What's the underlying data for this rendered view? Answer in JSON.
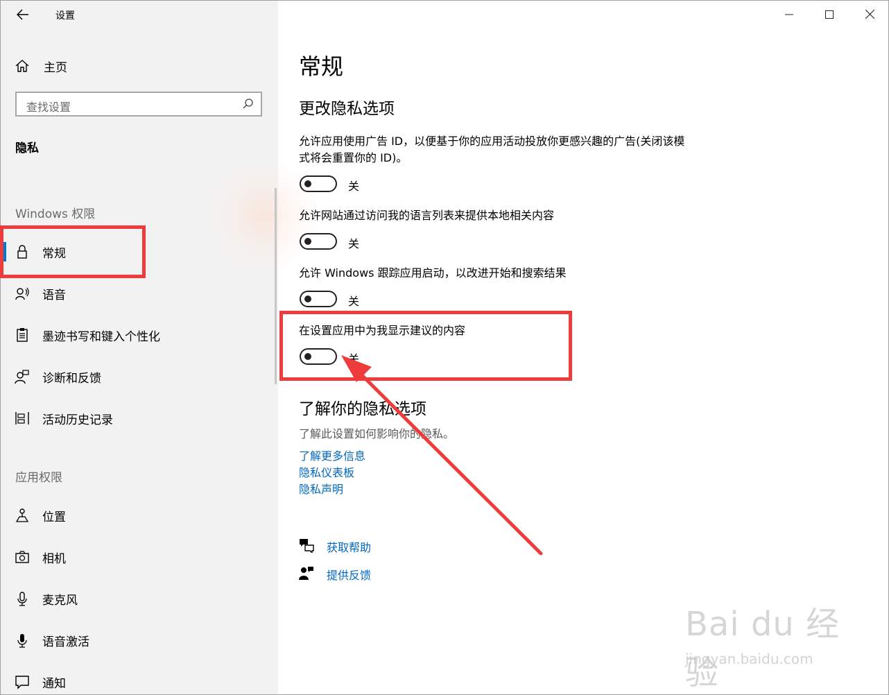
{
  "window": {
    "title": "设置",
    "controls": {
      "minimize": "—",
      "maximize": "☐",
      "close": "✕"
    }
  },
  "sidebar": {
    "home_label": "主页",
    "search_placeholder": "查找设置",
    "section_title": "隐私",
    "windows_group_label": "Windows 权限",
    "windows_items": [
      {
        "label": "常规",
        "icon": "lock-icon",
        "active": true
      },
      {
        "label": "语音",
        "icon": "speech-icon"
      },
      {
        "label": "墨迹书写和键入个性化",
        "icon": "clipboard-icon"
      },
      {
        "label": "诊断和反馈",
        "icon": "feedback-person-icon"
      },
      {
        "label": "活动历史记录",
        "icon": "timeline-icon"
      }
    ],
    "app_group_label": "应用权限",
    "app_items": [
      {
        "label": "位置",
        "icon": "location-icon"
      },
      {
        "label": "相机",
        "icon": "camera-icon"
      },
      {
        "label": "麦克风",
        "icon": "microphone-icon"
      },
      {
        "label": "语音激活",
        "icon": "voice-activation-icon"
      },
      {
        "label": "通知",
        "icon": "notification-icon"
      }
    ]
  },
  "main": {
    "page_title": "常规",
    "section_title": "更改隐私选项",
    "settings": [
      {
        "desc": "允许应用使用广告 ID，以便基于你的应用活动投放你更感兴趣的广告(关闭该模式将会重置你的 ID)。",
        "state": "关"
      },
      {
        "desc": "允许网站通过访问我的语言列表来提供本地相关内容",
        "state": "关"
      },
      {
        "desc": "允许 Windows 跟踪应用启动，以改进开始和搜索结果",
        "state": "关"
      },
      {
        "desc": "在设置应用中为我显示建议的内容",
        "state": "关"
      }
    ],
    "learn_title": "了解你的隐私选项",
    "learn_desc": "了解此设置如何影响你的隐私。",
    "links": [
      "了解更多信息",
      "隐私仪表板",
      "隐私声明"
    ],
    "help": {
      "get_help": "获取帮助",
      "give_feedback": "提供反馈"
    }
  },
  "annotation": {
    "highlight_color": "#ee3b3b"
  },
  "watermark": {
    "brand": "Bai du 经验",
    "url": "jingyan.baidu.com"
  }
}
